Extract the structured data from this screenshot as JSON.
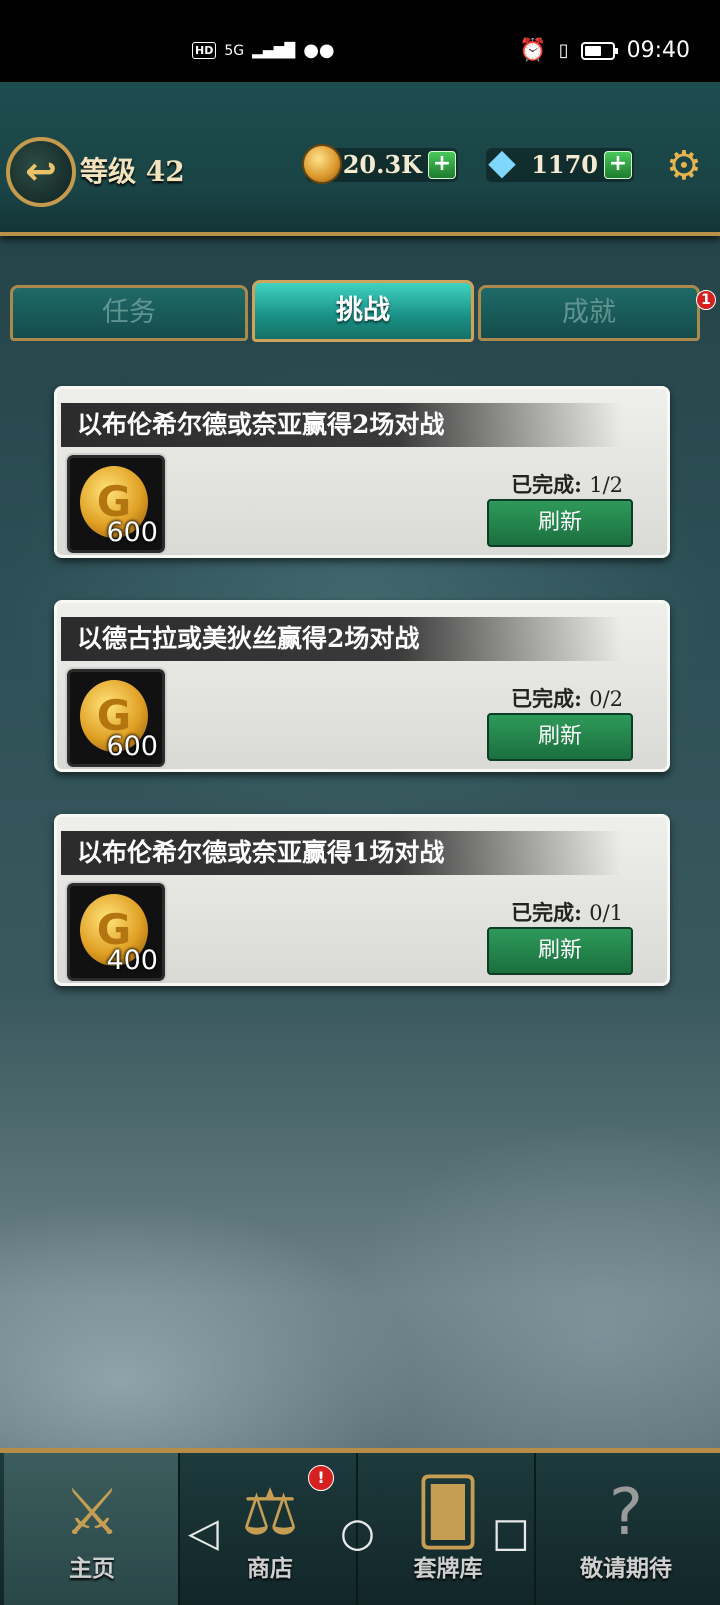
{
  "status_bar": {
    "network": "HD",
    "signal": "5G",
    "time": "09:40"
  },
  "header": {
    "back_icon": "back-arrow-icon",
    "level_label": "等级 42",
    "coins": "20.3K",
    "gems": "1170"
  },
  "tabs": [
    {
      "label": "任务",
      "active": false
    },
    {
      "label": "挑战",
      "active": true
    },
    {
      "label": "成就",
      "active": false,
      "badge": "1"
    }
  ],
  "tasks": [
    {
      "title": "以布伦希尔德或奈亚赢得2场对战",
      "reward": "600",
      "progress_label": "已完成:",
      "progress": "1/2",
      "button": "刷新"
    },
    {
      "title": "以德古拉或美狄丝赢得2场对战",
      "reward": "600",
      "progress_label": "已完成:",
      "progress": "0/2",
      "button": "刷新"
    },
    {
      "title": "以布伦希尔德或奈亚赢得1场对战",
      "reward": "400",
      "progress_label": "已完成:",
      "progress": "0/1",
      "button": "刷新"
    }
  ],
  "bottom_nav": [
    {
      "label": "主页",
      "icon": "crossed-swords-icon",
      "active": true
    },
    {
      "label": "商店",
      "icon": "scales-icon",
      "badge": "!"
    },
    {
      "label": "套牌库",
      "icon": "cards-icon"
    },
    {
      "label": "敬请期待",
      "icon": "question-icon"
    }
  ]
}
